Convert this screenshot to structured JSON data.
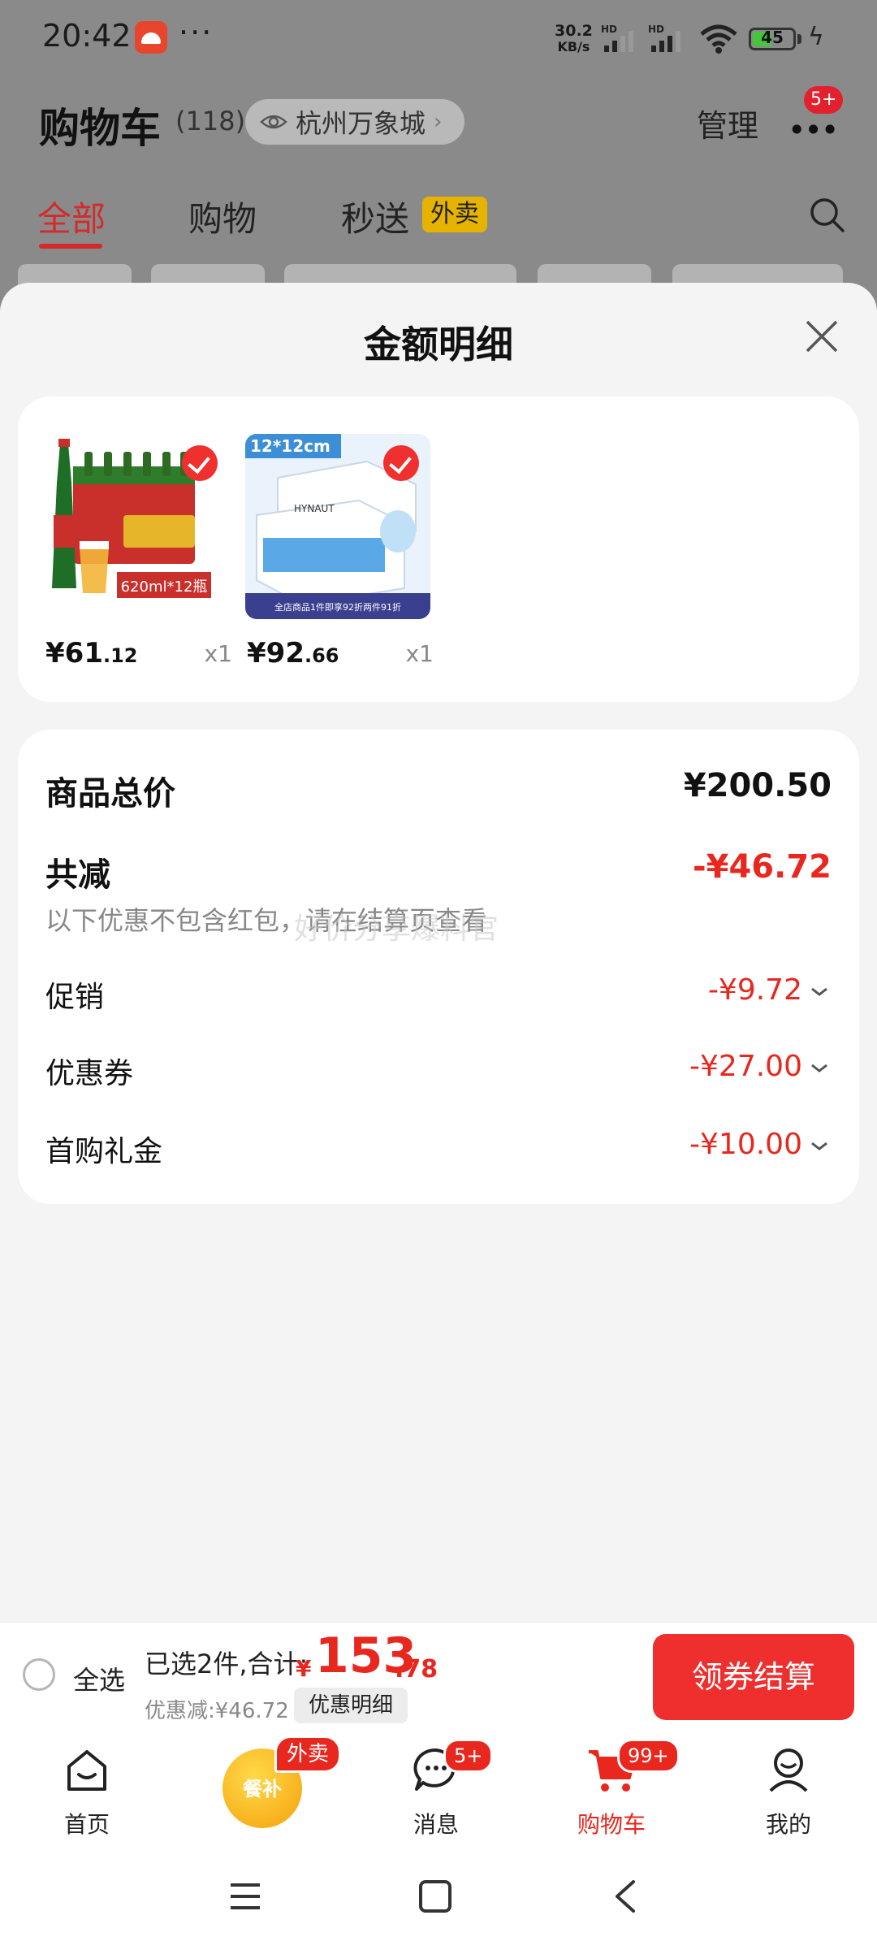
{
  "status_bar": {
    "time": "20:42",
    "more": "···",
    "network_speed_value": "30.2",
    "network_speed_unit": "KB/s",
    "signal_tag": "HD",
    "battery": "45",
    "battery_level": 0.45
  },
  "header": {
    "title": "购物车",
    "count": "(118)",
    "location": "杭州万象城",
    "manage": "管理",
    "more_badge": "5+"
  },
  "tabs": [
    {
      "label": "全部",
      "active": true
    },
    {
      "label": "购物",
      "active": false
    },
    {
      "label": "秒送",
      "active": false
    }
  ],
  "tab_tag": "外卖",
  "sheet": {
    "title": "金额明细",
    "products": [
      {
        "image_text": "620ml*12瓶",
        "price_int": "¥61",
        "price_dec": ".12",
        "qty": "x1",
        "checked": true
      },
      {
        "image_text": "12*12cm",
        "image_caption": "全店商品1件即享92折两件91折",
        "image_brand": "HYNAUT",
        "price_int": "¥92",
        "price_dec": ".66",
        "qty": "x1",
        "checked": true
      }
    ],
    "total_label": "商品总价",
    "total_value": "¥200.50",
    "reduction_label": "共减",
    "reduction_value": "-¥46.72",
    "note": "以下优惠不包含红包，请在结算页查看",
    "watermark": "好价分享爆料官",
    "rows": [
      {
        "label": "促销",
        "value": "-¥9.72"
      },
      {
        "label": "优惠券",
        "value": "-¥27.00"
      },
      {
        "label": "首购礼金",
        "value": "-¥10.00"
      }
    ]
  },
  "checkout": {
    "select_all": "全选",
    "summary_prefix": "已选2件,合计:",
    "currency": "¥",
    "total_int": "153",
    "total_dec": ".78",
    "discount_note": "优惠减:¥46.72",
    "detail_button": "优惠明细",
    "checkout_button": "领券结算"
  },
  "tabbar": [
    {
      "label": "首页",
      "icon": "home-icon"
    },
    {
      "label": "",
      "icon": "meal-subsidy-icon",
      "promo_text": "餐补",
      "badge": "外卖"
    },
    {
      "label": "消息",
      "icon": "message-icon",
      "badge": "5+"
    },
    {
      "label": "购物车",
      "icon": "cart-icon",
      "badge": "99+",
      "active": true
    },
    {
      "label": "我的",
      "icon": "profile-icon"
    }
  ],
  "colors": {
    "accent_red": "#e8271f",
    "button_red": "#ef2e2e",
    "tag_yellow": "#e6b400",
    "battery_green": "#46c63d"
  }
}
